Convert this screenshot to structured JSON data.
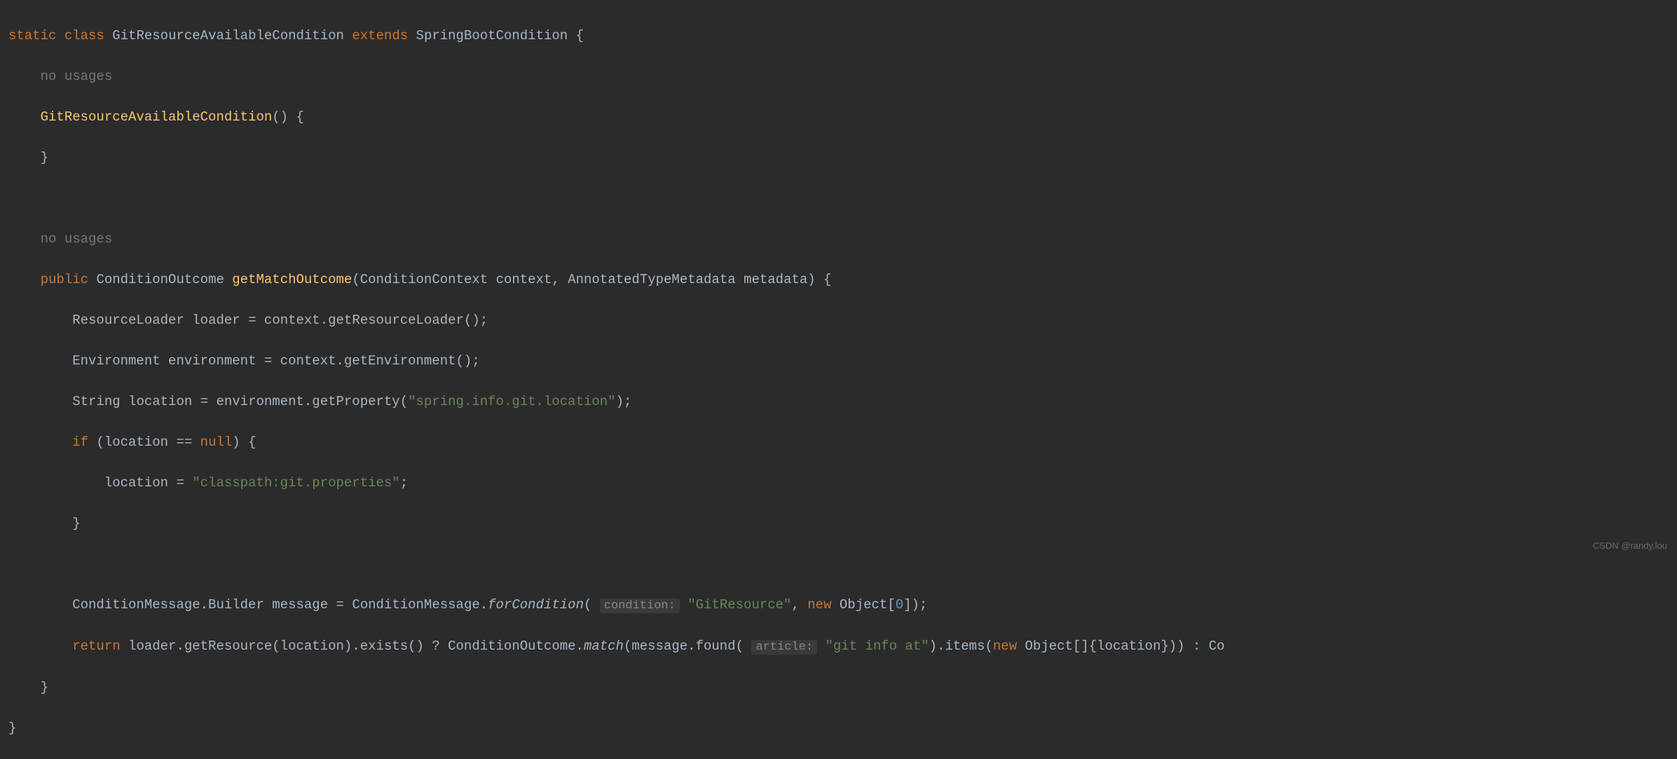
{
  "code": {
    "l1": {
      "static": "static",
      "class_kw": "class",
      "class_name": "GitResourceAvailableCondition",
      "extends": "extends",
      "super_class": "SpringBootCondition",
      "brace": " {"
    },
    "l2_hint": "no usages",
    "l3": {
      "ctor": "GitResourceAvailableCondition",
      "tail": "() {"
    },
    "l4_brace": "}",
    "l6_hint": "no usages",
    "l7": {
      "public_kw": "public",
      "return_type": "ConditionOutcome",
      "method": "getMatchOutcome",
      "params_open": "(",
      "p1_type": "ConditionContext",
      "p1_name": "context",
      "comma": ", ",
      "p2_type": "AnnotatedTypeMetadata",
      "p2_name": "metadata",
      "tail": ") {"
    },
    "l8": {
      "type": "ResourceLoader",
      "var": "loader",
      "assign": " = context.getResourceLoader();"
    },
    "l9": {
      "type": "Environment",
      "var": "environment",
      "assign": " = context.getEnvironment();"
    },
    "l10": {
      "type": "String",
      "var": "location",
      "assign": " = environment.getProperty(",
      "str": "\"spring.info.git.location\"",
      "tail": ");"
    },
    "l11": {
      "if_kw": "if",
      "cond_open": " (location == ",
      "null_kw": "null",
      "tail": ") {"
    },
    "l12": {
      "lhs": "location = ",
      "str": "\"classpath:git.properties\"",
      "tail": ";"
    },
    "l13_brace": "}",
    "l15": {
      "type": "ConditionMessage.Builder",
      "var": "message",
      "assign": " = ConditionMessage.",
      "static_call": "forCondition",
      "open": "(",
      "hint1": "condition:",
      "str1": "\"GitResource\"",
      "comma": ", ",
      "new_kw": "new",
      "obj": " Object[",
      "zero": "0",
      "tail": "]);"
    },
    "l16": {
      "return_kw": "return",
      "seg1": " loader.getResource(location).exists() ? ConditionOutcome.",
      "match": "match",
      "seg2": "(message.found(",
      "hint2": "article:",
      "str2": "\"git info at\"",
      "seg3": ").items(",
      "new_kw": "new",
      "seg4": " Object[]{location})) : Co"
    },
    "l17_brace": "}",
    "l18_brace": "}"
  },
  "watermark": "CSDN @randy.lou"
}
